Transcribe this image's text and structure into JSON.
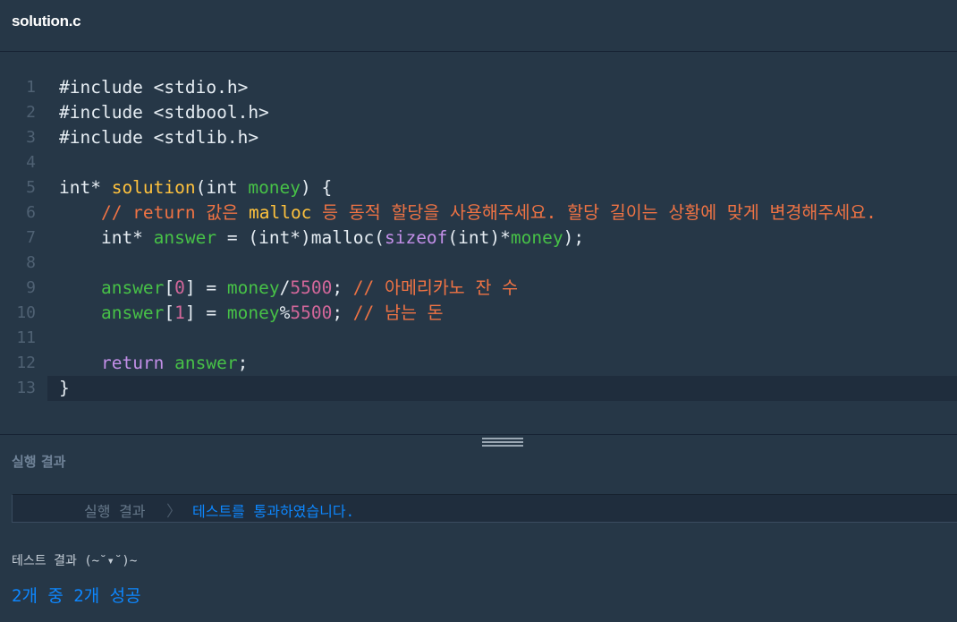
{
  "tab": {
    "title": "solution.c"
  },
  "code": {
    "active_line": 13,
    "lines": [
      {
        "n": "1",
        "tokens": [
          [
            "c-plain",
            "#include <stdio.h>"
          ]
        ]
      },
      {
        "n": "2",
        "tokens": [
          [
            "c-plain",
            "#include <stdbool.h>"
          ]
        ]
      },
      {
        "n": "3",
        "tokens": [
          [
            "c-plain",
            "#include <stdlib.h>"
          ]
        ]
      },
      {
        "n": "4",
        "tokens": []
      },
      {
        "n": "5",
        "tokens": [
          [
            "c-type",
            "int* "
          ],
          [
            "c-func",
            "solution"
          ],
          [
            "c-plain",
            "(int "
          ],
          [
            "c-var",
            "money"
          ],
          [
            "c-plain",
            ") {"
          ]
        ]
      },
      {
        "n": "6",
        "tokens": [
          [
            "c-comment",
            "    // return 값은 "
          ],
          [
            "c-func",
            "malloc"
          ],
          [
            "c-comment",
            " 등 동적 할당을 사용해주세요. 할당 길이는 상황에 맞게 변경해주세요."
          ]
        ]
      },
      {
        "n": "7",
        "tokens": [
          [
            "c-plain",
            "    int* "
          ],
          [
            "c-var",
            "answer"
          ],
          [
            "c-plain",
            " = (int*)malloc("
          ],
          [
            "c-kw",
            "sizeof"
          ],
          [
            "c-plain",
            "(int)*"
          ],
          [
            "c-var",
            "money"
          ],
          [
            "c-plain",
            ");"
          ]
        ]
      },
      {
        "n": "8",
        "tokens": []
      },
      {
        "n": "9",
        "tokens": [
          [
            "c-plain",
            "    "
          ],
          [
            "c-var",
            "answer"
          ],
          [
            "c-plain",
            "["
          ],
          [
            "c-num",
            "0"
          ],
          [
            "c-plain",
            "] = "
          ],
          [
            "c-var",
            "money"
          ],
          [
            "c-plain",
            "/"
          ],
          [
            "c-num",
            "5500"
          ],
          [
            "c-plain",
            "; "
          ],
          [
            "c-comment",
            "// 아메리카노 잔 수"
          ]
        ]
      },
      {
        "n": "10",
        "tokens": [
          [
            "c-plain",
            "    "
          ],
          [
            "c-var",
            "answer"
          ],
          [
            "c-plain",
            "["
          ],
          [
            "c-num",
            "1"
          ],
          [
            "c-plain",
            "] = "
          ],
          [
            "c-var",
            "money"
          ],
          [
            "c-plain",
            "%"
          ],
          [
            "c-num",
            "5500"
          ],
          [
            "c-plain",
            "; "
          ],
          [
            "c-comment",
            "// 남는 돈"
          ]
        ]
      },
      {
        "n": "11",
        "tokens": []
      },
      {
        "n": "12",
        "tokens": [
          [
            "c-plain",
            "    "
          ],
          [
            "c-kw",
            "return"
          ],
          [
            "c-plain",
            " "
          ],
          [
            "c-var",
            "answer"
          ],
          [
            "c-plain",
            ";"
          ]
        ]
      },
      {
        "n": "13",
        "tokens": [
          [
            "c-plain",
            "}"
          ]
        ]
      }
    ]
  },
  "result": {
    "header": "실행 결과",
    "status_label": "실행 결과",
    "status_arrow": "〉",
    "status_message": "테스트를 통과하였습니다.",
    "test_label": "테스트 결과 (~˘▾˘)~",
    "summary": "2개 중 2개 성공"
  },
  "colors": {
    "background": "#263747",
    "success": "#0d87ff",
    "comment": "#ef7344",
    "function": "#ffc23d",
    "variable": "#47c147",
    "keyword": "#c38fe8",
    "number": "#d2679a"
  }
}
